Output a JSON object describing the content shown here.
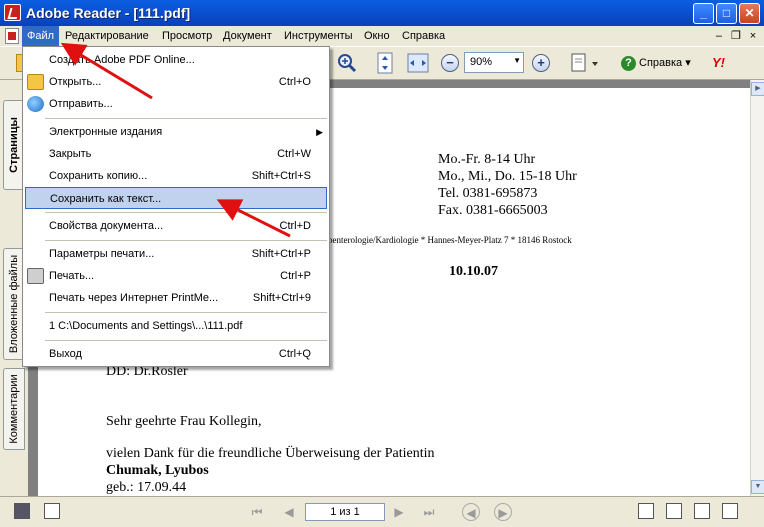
{
  "window": {
    "title": "Adobe Reader - [111.pdf]",
    "min": "_",
    "max": "□",
    "close": "✕"
  },
  "menubar": {
    "items": [
      "Файл",
      "Редактирование",
      "Просмотр",
      "Документ",
      "Инструменты",
      "Окно",
      "Справка"
    ],
    "mdi": {
      "min": "–",
      "restore": "❐",
      "close": "×"
    }
  },
  "toolbar": {
    "zoom": "90%",
    "help_label": "Справка",
    "yahoo": "Y!"
  },
  "left_tabs": [
    "Страницы",
    "Вложенные файлы",
    "Комментарии"
  ],
  "file_menu": [
    {
      "label": "Создать Adobe PDF Online...",
      "shortcut": ""
    },
    {
      "label": "Открыть...",
      "shortcut": "Ctrl+O",
      "icon": "folder-icon"
    },
    {
      "label": "Отправить...",
      "shortcut": "",
      "icon": "globe-icon"
    },
    {
      "label": "Электронные издания",
      "shortcut": "",
      "submenu": "▶"
    },
    {
      "label": "Закрыть",
      "shortcut": "Ctrl+W"
    },
    {
      "label": "Сохранить копию...",
      "shortcut": "Shift+Ctrl+S"
    },
    {
      "label": "Сохранить как текст...",
      "shortcut": ""
    },
    {
      "label": "Свойства документа...",
      "shortcut": "Ctrl+D"
    },
    {
      "label": "Параметры печати...",
      "shortcut": "Shift+Ctrl+P"
    },
    {
      "label": "Печать...",
      "shortcut": "Ctrl+P",
      "icon": "printer-icon"
    },
    {
      "label": "Печать через Интернет PrintMe...",
      "shortcut": "Shift+Ctrl+9"
    },
    {
      "label": "1 C:\\Documents and Settings\\...\\111.pdf",
      "shortcut": ""
    },
    {
      "label": "Выход",
      "shortcut": "Ctrl+Q"
    }
  ],
  "document": {
    "hours": [
      "Mo.-Fr.  8-14 Uhr",
      "Mo., Mi., Do.  15-18 Uhr",
      "Tel.  0381-695873",
      "Fax.  0381-6665003"
    ],
    "address_line": "oenterologie/Kardiologie * Hannes-Meyer-Platz 7 * 18146 Rostock",
    "date": "10.10.07",
    "dd": "DD: Dr.Rosler",
    "greeting": "Sehr geehrte Frau Kollegin,",
    "body": "vielen Dank für die freundliche Überweisung der  Patientin",
    "patient": "Chumak, Lyubos",
    "dob": "geb.:  17.09.44"
  },
  "statusbar": {
    "page_indicator": "1 из 1"
  }
}
